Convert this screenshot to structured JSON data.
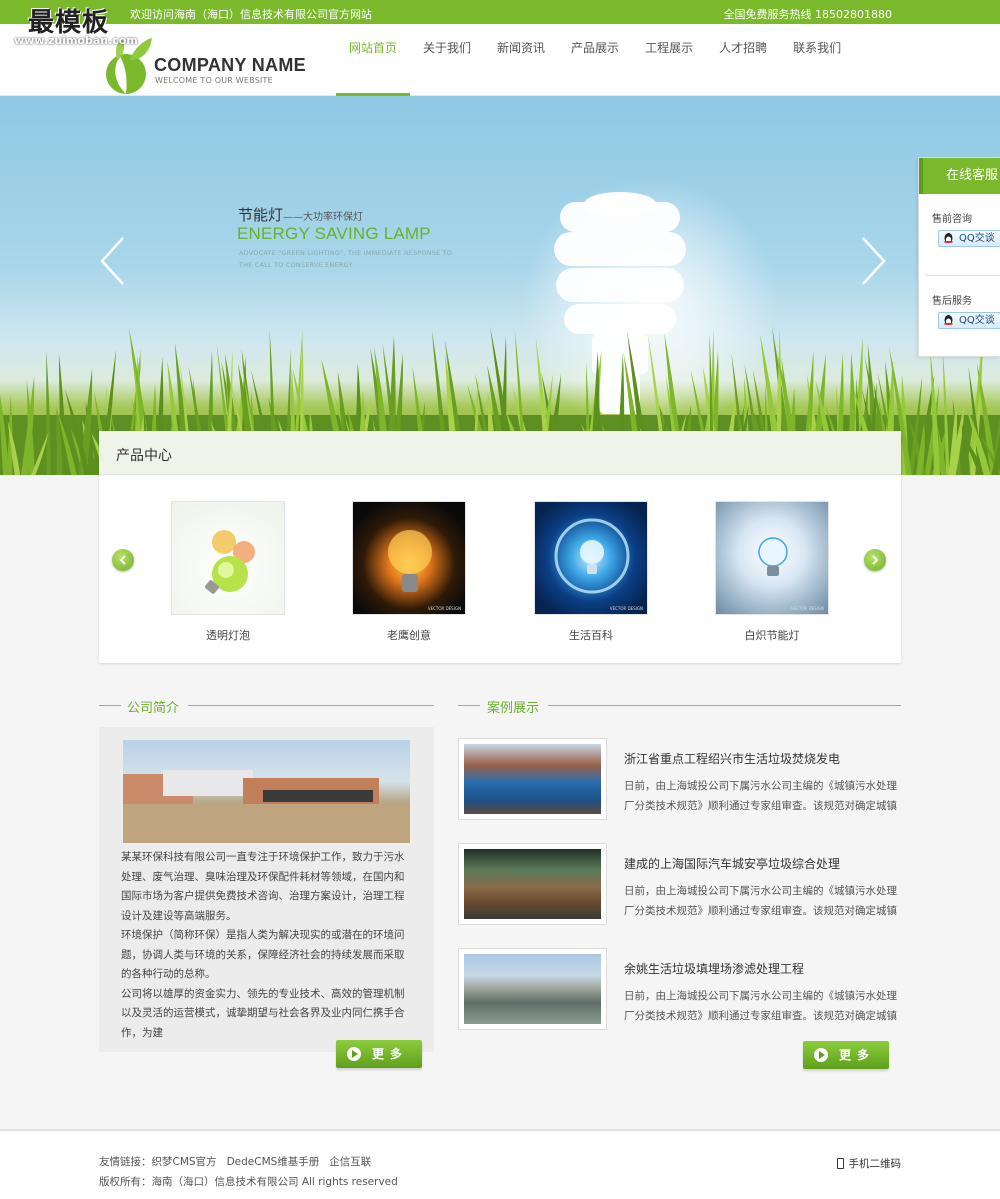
{
  "watermark": {
    "title": "最模板",
    "url": "www.zuimoban.com"
  },
  "topbar": {
    "left_text": "欢迎访问海南（海口）信息技术有限公司官方网站",
    "right_text": "全国免费服务热线 18502801880"
  },
  "logo": {
    "name": "COMPANY NAME",
    "slogan": "WELCOME TO OUR WEBSITE"
  },
  "nav": {
    "items": [
      "网站首页",
      "关于我们",
      "新闻资讯",
      "产品展示",
      "工程展示",
      "人才招聘",
      "联系我们"
    ],
    "active_index": 0
  },
  "banner": {
    "title_cn": "节能灯",
    "title_cn_sub": "——大功率环保灯",
    "title_en": "ENERGY SAVING LAMP",
    "desc": "ADVOCATE \"GREEN LIGHTING\", THE IMMEDIATE RESPONSE TO THE CALL TO CONSERVE ENERGY"
  },
  "service": {
    "title": "在线客服",
    "groups": [
      {
        "label": "售前咨询",
        "button": "QQ交谈"
      },
      {
        "label": "售后服务",
        "button": "QQ交谈"
      }
    ]
  },
  "products": {
    "title": "产品中心",
    "items": [
      {
        "caption": "透明灯泡"
      },
      {
        "caption": "老鹰创意",
        "tag": "VECTOR DESIGN"
      },
      {
        "caption": "生活百科",
        "tag": "VECTOR DESIGN"
      },
      {
        "caption": "白炽节能灯",
        "tag": "VECTOR DESIGN"
      }
    ]
  },
  "about": {
    "heading": "公司简介",
    "paragraphs": [
      "某某环保科技有限公司一直专注于环境保护工作，致力于污水处理、废气治理、臭味治理及环保配件耗材等领域，在国内和国际市场为客户提供免费技术咨询、治理方案设计，治理工程设计及建设等高端服务。",
      "环境保护（简称环保）是指人类为解决现实的或潜在的环境问题，协调人类与环境的关系，保障经济社会的持续发展而采取的各种行动的总称。",
      "公司将以雄厚的资金实力、领先的专业技术、高效的管理机制以及灵活的运营模式，诚挚期望与社会各界及业内同仁携手合作，为建"
    ],
    "more": "更多"
  },
  "cases": {
    "heading": "案例展示",
    "items": [
      {
        "title": "浙江省重点工程绍兴市生活垃圾焚烧发电",
        "desc": "日前，由上海城投公司下属污水公司主编的《城镇污水处理厂分类技术规范》顺利通过专家组审查。该规范对确定城镇污水处..."
      },
      {
        "title": "建成的上海国际汽车城安亭垃圾综合处理",
        "desc": "日前，由上海城投公司下属污水公司主编的《城镇污水处理厂分类技术规范》顺利通过专家组审查。该规范对确定城镇污水处..."
      },
      {
        "title": "余姚生活垃圾填埋场渗滤处理工程",
        "desc": "日前，由上海城投公司下属污水公司主编的《城镇污水处理厂分类技术规范》顺利通过专家组审查。该规范对确定城镇污水处..."
      }
    ],
    "more": "更多"
  },
  "footer": {
    "links_label": "友情链接：",
    "links": [
      "织梦CMS官方",
      "DedeCMS维基手册",
      "企信互联"
    ],
    "copyright": "版权所有：海南（海口）信息技术有限公司 All rights reserved",
    "mobile": "手机二维码"
  },
  "colors": {
    "brand": "#7ab92c",
    "brand_dark": "#5f9d1e"
  }
}
